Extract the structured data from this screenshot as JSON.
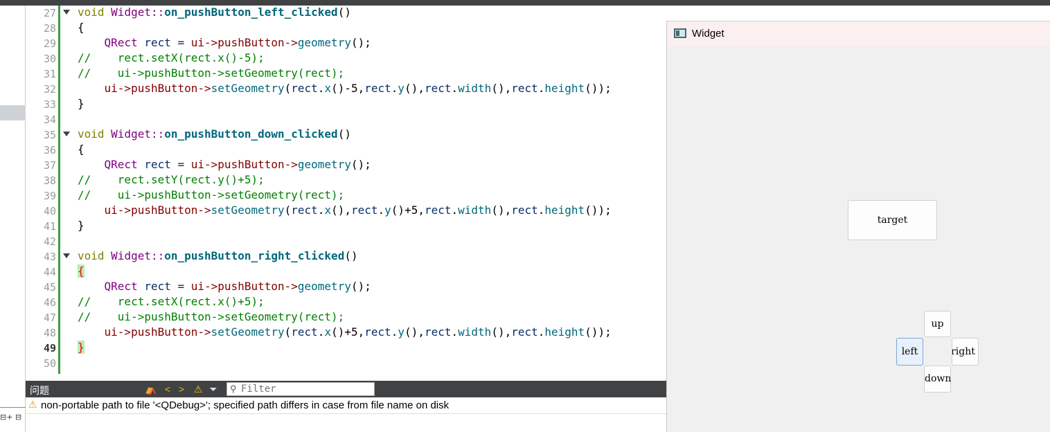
{
  "editor": {
    "line_numbers": [
      "27",
      "28",
      "29",
      "30",
      "31",
      "32",
      "33",
      "34",
      "35",
      "36",
      "37",
      "38",
      "39",
      "40",
      "41",
      "42",
      "43",
      "44",
      "45",
      "46",
      "47",
      "48",
      "49",
      "50"
    ],
    "tokens": {
      "void": "void",
      "widget_scope": "Widget::",
      "fn_left": "on_pushButton_left_clicked",
      "fn_down": "on_pushButton_down_clicked",
      "fn_right": "on_pushButton_right_clicked",
      "parens": "()",
      "open_brace": "{",
      "close_brace": "}",
      "qrect": "QRect",
      "rect_decl": " rect = ",
      "ui": "ui",
      "arrow_pb": "->pushButton->",
      "geometry": "geometry",
      "call_end": "();",
      "set_geometry": "setGeometry",
      "c30": "//    rect.setX(rect.x()-5);",
      "c31": "//    ui->pushButton->setGeometry(rect);",
      "c38": "//    rect.setY(rect.y()+5);",
      "c39": "//    ui->pushButton->setGeometry(rect);",
      "c46": "//    rect.setX(rect.x()+5);",
      "c47": "//    ui->pushButton->setGeometry(rect);",
      "rect": "rect",
      "dot": ".",
      "x": "x",
      "y": "y",
      "width": "width",
      "height": "height",
      "paren_open": "(",
      "paren_close": ")",
      "comma": ",",
      "minus5": "-5",
      "plus5": "+5",
      "end": "());"
    }
  },
  "issues": {
    "title": "问题",
    "filter_placeholder": "Filter",
    "message": "non-portable path to file '<QDebug>'; specified path differs in case from file name on disk"
  },
  "widget_window": {
    "title": "Widget",
    "buttons": {
      "target": "target",
      "up": "up",
      "left": "left",
      "right": "right",
      "down": "down"
    }
  },
  "colors": {
    "keyword": "#808000",
    "class": "#800080",
    "function": "#00677c",
    "comment": "#008000",
    "change_bar": "#3f9d3f"
  }
}
